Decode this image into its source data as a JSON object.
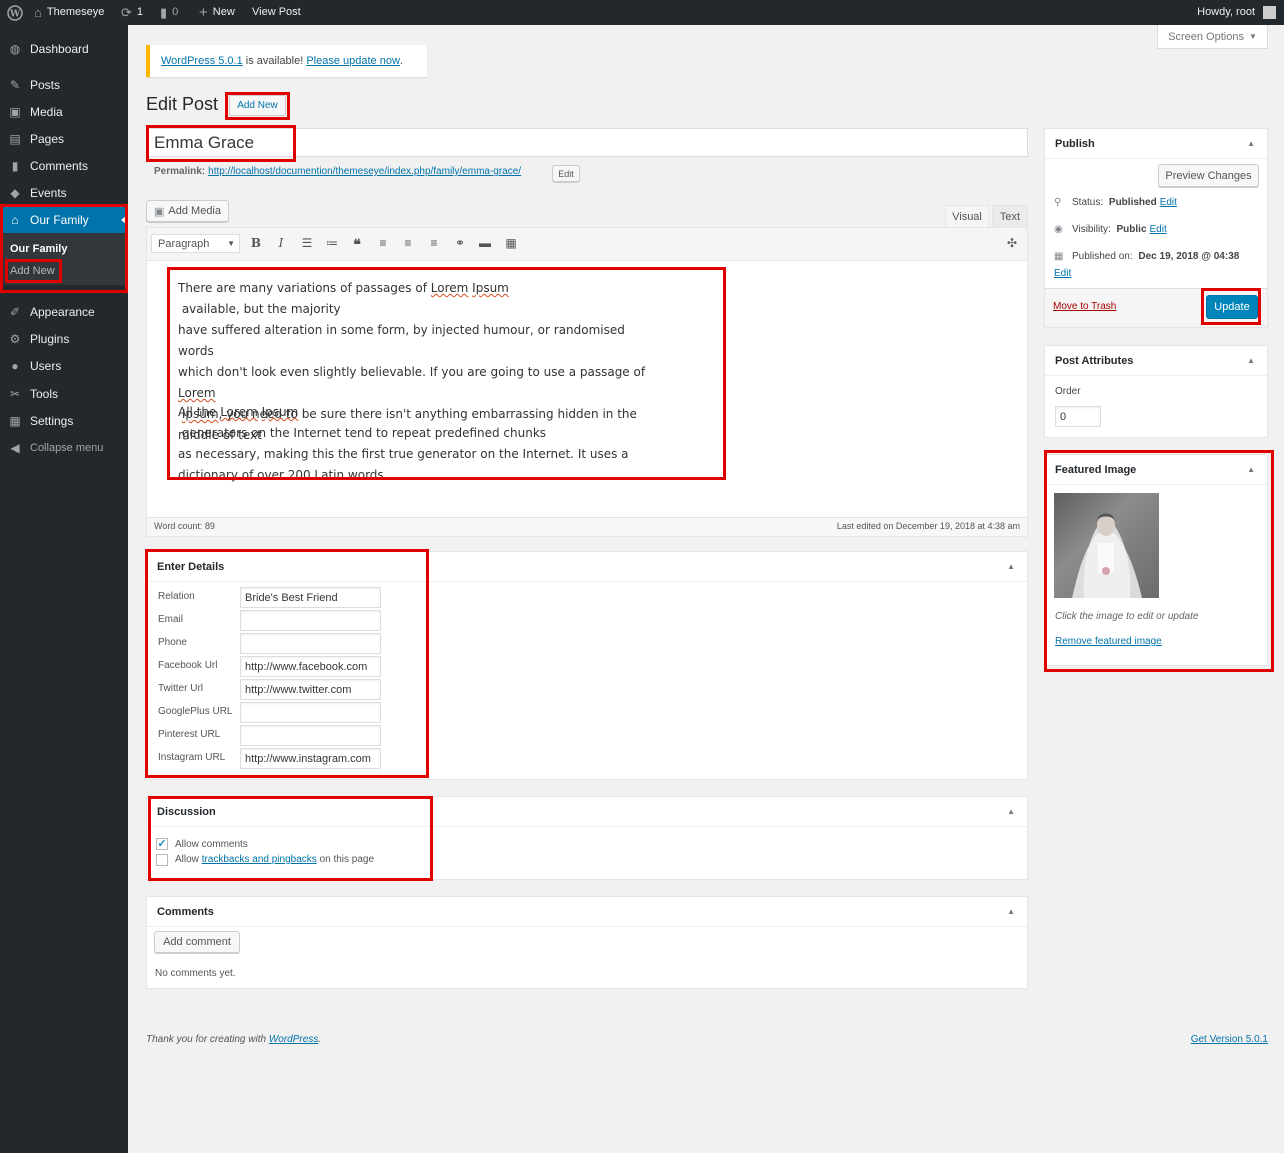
{
  "adminbar": {
    "site_name": "Themeseye",
    "updates_count": "1",
    "comments_count": "0",
    "new_label": "New",
    "view_post": "View Post",
    "howdy": "Howdy, root"
  },
  "sidebar": {
    "items": [
      {
        "label": "Dashboard",
        "icon": "dashboard-icon"
      },
      {
        "label": "Posts",
        "icon": "pin-icon"
      },
      {
        "label": "Media",
        "icon": "media-icon"
      },
      {
        "label": "Pages",
        "icon": "pages-icon"
      },
      {
        "label": "Comments",
        "icon": "comment-icon"
      },
      {
        "label": "Events",
        "icon": "tag-icon"
      },
      {
        "label": "Our Family",
        "icon": "graduation-cap-icon"
      },
      {
        "label": "Appearance",
        "icon": "brush-icon"
      },
      {
        "label": "Plugins",
        "icon": "plugin-icon"
      },
      {
        "label": "Users",
        "icon": "user-icon"
      },
      {
        "label": "Tools",
        "icon": "wrench-icon"
      },
      {
        "label": "Settings",
        "icon": "settings-icon"
      },
      {
        "label": "Collapse menu",
        "icon": "collapse-icon"
      }
    ],
    "submenu": [
      "Our Family",
      "Add New"
    ]
  },
  "screen_options": "Screen Options",
  "notice": {
    "version_link": "WordPress 5.0.1",
    "middle": " is available! ",
    "update_link": "Please update now",
    "end": "."
  },
  "page": {
    "title": "Edit Post",
    "add_new": "Add New",
    "post_title": "Emma Grace",
    "permalink_label": "Permalink:",
    "permalink_url": "http://localhost/documention/themeseye/index.php/family/emma-grace/",
    "permalink_edit": "Edit"
  },
  "editor": {
    "add_media": "Add Media",
    "tab_visual": "Visual",
    "tab_text": "Text",
    "format_select": "Paragraph",
    "word_count": "Word count: 89",
    "last_edited": "Last edited on December 19, 2018 at 4:38 am",
    "content": {
      "p1_l1_a": "There are many variations of passages of ",
      "p1_l1_b": "Lorem",
      "p1_l1_c": " ",
      "p1_l1_d": "Ipsum",
      "p1_l1_e": " available, but the majority",
      "p1_l2": "have suffered alteration in some form, by injected humour, or randomised words",
      "p1_l3": "which don't look even slightly believable. If you are going to use a passage of",
      "p1_l4_a": "Lorem",
      "p1_l4_b": " ",
      "p1_l4_c": "Ipsum",
      "p1_l4_d": ", you need to be sure there isn't anything embarrassing hidden in the",
      "p1_l5": "middle of text",
      "p2_l1_a": "All the ",
      "p2_l1_b": "Lorem",
      "p2_l1_c": " ",
      "p2_l1_d": "Ipsum",
      "p2_l1_e": " generators on the Internet tend to repeat predefined chunks",
      "p2_l2": "as necessary, making this the first true generator on the Internet. It uses a",
      "p2_l3": "dictionary of over 200 Latin words"
    }
  },
  "details": {
    "title": "Enter Details",
    "fields": [
      {
        "label": "Relation",
        "value": "Bride's Best Friend"
      },
      {
        "label": "Email",
        "value": ""
      },
      {
        "label": "Phone",
        "value": ""
      },
      {
        "label": "Facebook Url",
        "value": "http://www.facebook.com"
      },
      {
        "label": "Twitter Url",
        "value": "http://www.twitter.com"
      },
      {
        "label": "GooglePlus URL",
        "value": ""
      },
      {
        "label": "Pinterest URL",
        "value": ""
      },
      {
        "label": "Instagram URL",
        "value": "http://www.instagram.com"
      }
    ]
  },
  "discussion": {
    "title": "Discussion",
    "allow_comments": "Allow comments",
    "allow_prefix": "Allow ",
    "trackbacks_link": "trackbacks and pingbacks",
    "allow_suffix": " on this page"
  },
  "comments_box": {
    "title": "Comments",
    "add_comment": "Add comment",
    "none": "No comments yet."
  },
  "publish": {
    "title": "Publish",
    "preview": "Preview Changes",
    "status_label": "Status: ",
    "status_value": "Published",
    "visibility_label": "Visibility: ",
    "visibility_value": "Public",
    "published_label": "Published on: ",
    "published_value": "Dec 19, 2018 @ 04:38",
    "edit": "Edit",
    "trash": "Move to Trash",
    "update": "Update"
  },
  "attributes": {
    "title": "Post Attributes",
    "order_label": "Order",
    "order_value": "0"
  },
  "featured": {
    "title": "Featured Image",
    "hint": "Click the image to edit or update",
    "remove": "Remove featured image"
  },
  "footer": {
    "thanks": "Thank you for creating with ",
    "wp_link": "WordPress",
    "dot": ".",
    "version": "Get Version 5.0.1"
  },
  "colors": {
    "accent": "#0073aa",
    "sidebar_bg": "#23282d",
    "highlight": "#e00000"
  }
}
